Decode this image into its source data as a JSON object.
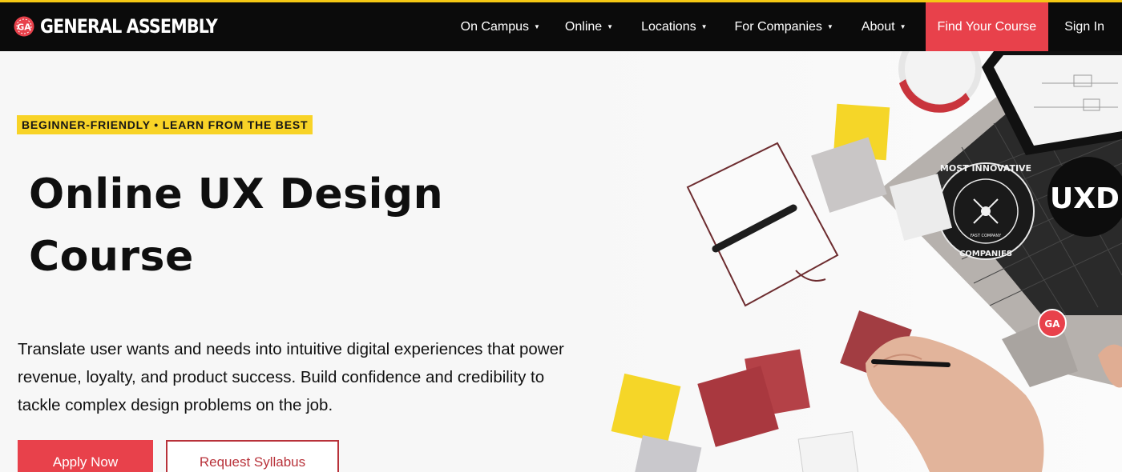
{
  "brand": {
    "name": "GENERAL ASSEMBLY",
    "badge_text": "GA"
  },
  "nav": {
    "items": [
      {
        "label": "On Campus",
        "has_dropdown": true
      },
      {
        "label": "Online",
        "has_dropdown": true
      },
      {
        "label": "Locations",
        "has_dropdown": true
      },
      {
        "label": "For Companies",
        "has_dropdown": true
      },
      {
        "label": "About",
        "has_dropdown": true
      }
    ],
    "cta_label": "Find Your Course",
    "signin_label": "Sign In",
    "caret": "▼"
  },
  "hero": {
    "badge": "BEGINNER-FRIENDLY • LEARN FROM THE BEST",
    "title_line1": "Online UX Design",
    "title_line2": "Course",
    "description": "Translate user wants and needs into intuitive digital experiences that power revenue, loyalty, and product success. Build confidence and credibility to tackle complex design problems on the job.",
    "primary_button": "Apply Now",
    "secondary_button": "Request Syllabus"
  },
  "photo": {
    "sticker_uxd": "UXD",
    "sticker_award_top": "MOST INNOVATIVE",
    "sticker_award_bottom": "COMPANIES",
    "sticker_award_small": "FAST COMPANY",
    "sticker_ga": "GA"
  },
  "colors": {
    "accent": "#e8414b",
    "highlight": "#f8d327",
    "header": "#0b0b0b"
  }
}
